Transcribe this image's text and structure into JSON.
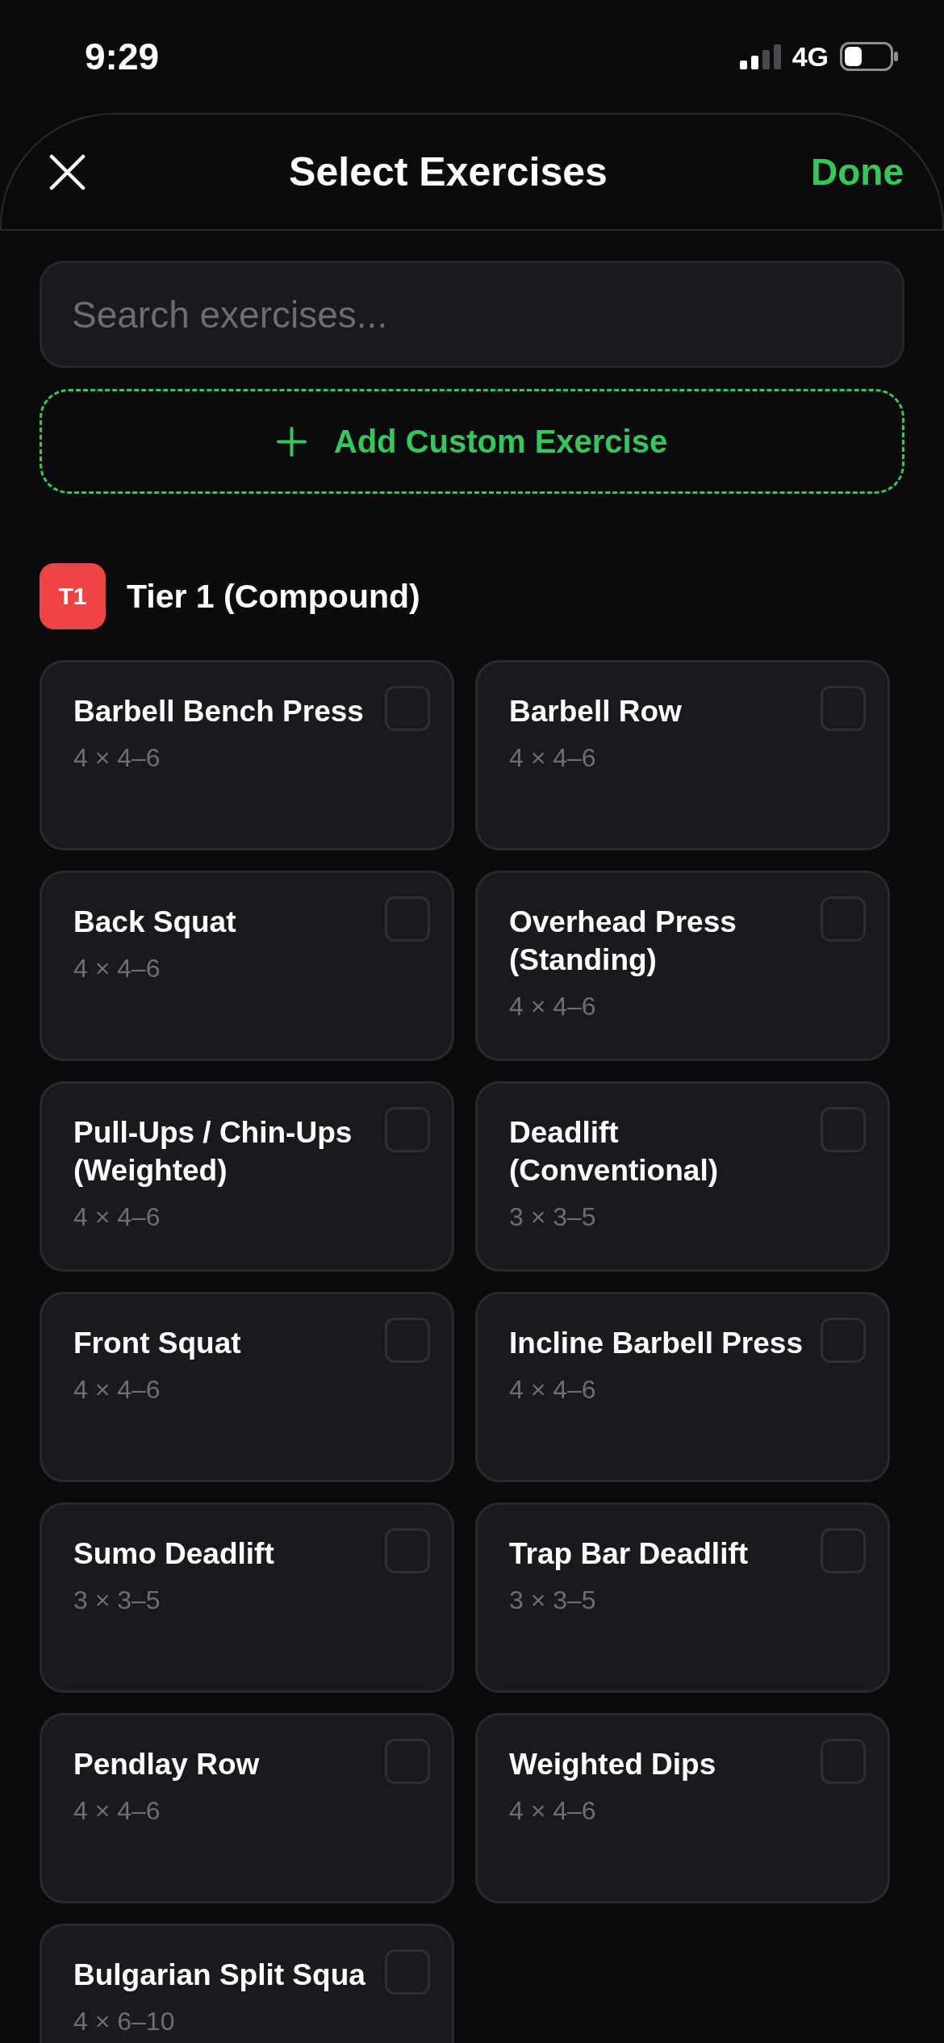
{
  "status_bar": {
    "time": "9:29",
    "network": "4G"
  },
  "header": {
    "title": "Select Exercises",
    "done": "Done"
  },
  "search": {
    "placeholder": "Search exercises..."
  },
  "add_custom": {
    "label": "Add Custom Exercise"
  },
  "sections": [
    {
      "badge": "T1",
      "color": "#ef4444",
      "title": "Tier 1 (Compound)",
      "exercises": [
        {
          "name": "Barbell Bench Press",
          "scheme": "4 × 4–6",
          "checked": false
        },
        {
          "name": "Barbell Row",
          "scheme": "4 × 4–6",
          "checked": false
        },
        {
          "name": "Back Squat",
          "scheme": "4 × 4–6",
          "checked": false
        },
        {
          "name": "Overhead Press (Standing)",
          "scheme": "4 × 4–6",
          "checked": false
        },
        {
          "name": "Pull-Ups / Chin-Ups (Weighted)",
          "scheme": "4 × 4–6",
          "checked": false
        },
        {
          "name": "Deadlift (Conventional)",
          "scheme": "3 × 3–5",
          "checked": false
        },
        {
          "name": "Front Squat",
          "scheme": "4 × 4–6",
          "checked": false
        },
        {
          "name": "Incline Barbell Press",
          "scheme": "4 × 4–6",
          "checked": false
        },
        {
          "name": "Sumo Deadlift",
          "scheme": "3 × 3–5",
          "checked": false
        },
        {
          "name": "Trap Bar Deadlift",
          "scheme": "3 × 3–5",
          "checked": false
        },
        {
          "name": "Pendlay Row",
          "scheme": "4 × 4–6",
          "checked": false
        },
        {
          "name": "Weighted Dips",
          "scheme": "4 × 4–6",
          "checked": false
        },
        {
          "name": "Bulgarian Split Squa",
          "scheme": "4 × 6–10",
          "checked": false
        }
      ]
    }
  ]
}
